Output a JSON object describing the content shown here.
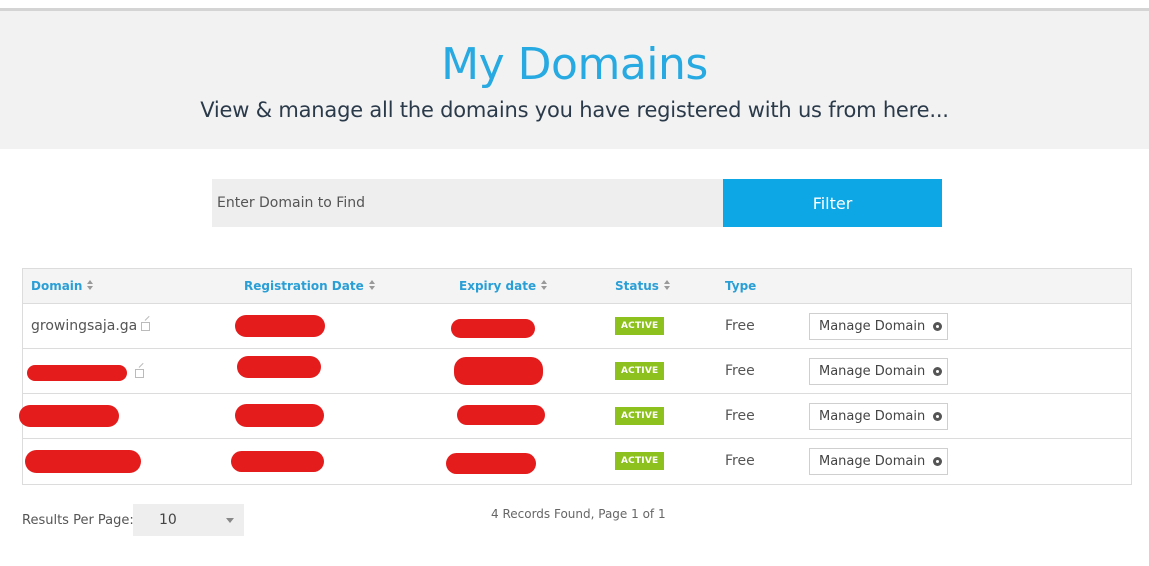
{
  "header": {
    "title": "My Domains",
    "subtitle": "View & manage all the domains you have registered with us from here..."
  },
  "search": {
    "placeholder": "Enter Domain to Find",
    "button_label": "Filter"
  },
  "table": {
    "columns": [
      "Domain",
      "Registration Date",
      "Expiry date",
      "Status",
      "Type"
    ],
    "rows": [
      {
        "domain": "growingsaja.ga",
        "status": "ACTIVE",
        "type": "Free",
        "action": "Manage Domain"
      },
      {
        "domain": "",
        "status": "ACTIVE",
        "type": "Free",
        "action": "Manage Domain"
      },
      {
        "domain": "",
        "status": "ACTIVE",
        "type": "Free",
        "action": "Manage Domain"
      },
      {
        "domain": "",
        "status": "ACTIVE",
        "type": "Free",
        "action": "Manage Domain"
      }
    ]
  },
  "footer": {
    "results_per_page_label": "Results Per Page:",
    "results_per_page_value": "10",
    "records_text": "4 Records Found, Page 1 of 1"
  },
  "colors": {
    "accent": "#27a9e1",
    "filter_button": "#0ea7e5",
    "active_badge": "#8dc11e",
    "redaction": "#e41c1c"
  }
}
